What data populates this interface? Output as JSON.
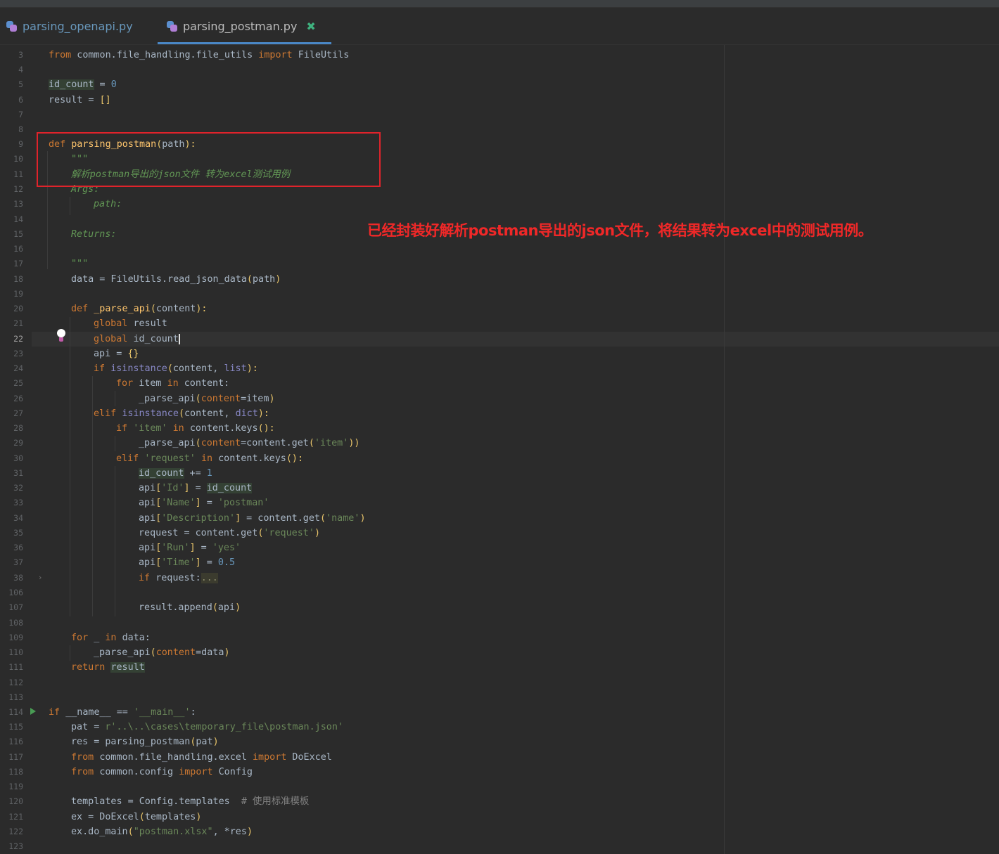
{
  "tabs": [
    {
      "label": "parsing_openapi.py"
    },
    {
      "label": "parsing_postman.py",
      "close": "✖"
    }
  ],
  "annotation": "已经封装好解析postman导出的json文件，将结果转为excel中的测试用例。",
  "line_numbers": [
    "3",
    "4",
    "5",
    "6",
    "7",
    "8",
    "9",
    "10",
    "11",
    "12",
    "13",
    "14",
    "15",
    "16",
    "17",
    "18",
    "19",
    "20",
    "21",
    "22",
    "23",
    "24",
    "25",
    "26",
    "27",
    "28",
    "29",
    "30",
    "31",
    "32",
    "33",
    "34",
    "35",
    "36",
    "37",
    "38",
    "106",
    "107",
    "108",
    "109",
    "110",
    "111",
    "112",
    "113",
    "114",
    "115",
    "116",
    "117",
    "118",
    "119",
    "120",
    "121",
    "122",
    "123"
  ],
  "current_line": "22",
  "code": {
    "l3": {
      "a": "from",
      "b": " common.file_handling.file_utils ",
      "c": "import",
      "d": " FileUtils"
    },
    "l5": {
      "a": "id_count",
      "b": " = ",
      "c": "0"
    },
    "l6": {
      "a": "result = ",
      "b": "[]"
    },
    "l9": {
      "a": "def ",
      "b": "parsing_postman",
      "c": "(",
      "d": "path",
      "e": "):"
    },
    "l10": "\"\"\"",
    "l11": "解析postman导出的json文件 转为excel测试用例",
    "l12": "Args:",
    "l13": "path:",
    "l15": "Returns:",
    "l17": "\"\"\"",
    "l18": {
      "a": "data = FileUtils.read_json_data",
      "b": "(",
      "c": "path",
      "d": ")"
    },
    "l20": {
      "a": "def ",
      "b": "_parse_api",
      "c": "(",
      "d": "content",
      "e": "):"
    },
    "l21": {
      "a": "global ",
      "b": "result"
    },
    "l22": {
      "a": "global ",
      "b": "id_count"
    },
    "l23": {
      "a": "api = ",
      "b": "{}"
    },
    "l24": {
      "a": "if ",
      "b": "isinstance",
      "c": "(",
      "d": "content, ",
      "e": "list",
      "f": "):"
    },
    "l25": {
      "a": "for ",
      "b": "item ",
      "c": "in ",
      "d": "content:"
    },
    "l26": {
      "a": "_parse_api",
      "b": "(",
      "c": "content",
      "d": "=item",
      ",e": "",
      "e": ")"
    },
    "l27": {
      "a": "elif ",
      "b": "isinstance",
      "c": "(",
      "d": "content, ",
      "e": "dict",
      "f": "):"
    },
    "l28": {
      "a": "if ",
      "b": "'item' ",
      "c": "in ",
      "d": "content.keys",
      "e": "():"
    },
    "l29": {
      "a": "_parse_api",
      "b": "(",
      "c": "content",
      "d": "=content.get",
      "e": "(",
      "f": "'item'",
      "g": "))"
    },
    "l30": {
      "a": "elif ",
      "b": "'request' ",
      "c": "in ",
      "d": "content.keys",
      "e": "():"
    },
    "l31": {
      "a": "id_count",
      " b": "",
      "b": " += ",
      "c": "1"
    },
    "l32": {
      "a": "api",
      "b": "[",
      "c": "'Id'",
      "d": "]",
      " e": "",
      "e": " = ",
      "f": "id_count"
    },
    "l33": {
      "a": "api",
      "b": "[",
      "c": "'Name'",
      "d": "]",
      "e": " = ",
      "f": "'postman'"
    },
    "l34": {
      "a": "api",
      "b": "[",
      "c": "'Description'",
      "d": "]",
      "e": " = content.get",
      "f": "(",
      "g": "'name'",
      "h": ")"
    },
    "l35": {
      "a": "request = content.get",
      "b": "(",
      "c": "'request'",
      "d": ")"
    },
    "l36": {
      "a": "api",
      "b": "[",
      "c": "'Run'",
      "d": "]",
      "e": " = ",
      "f": "'yes'"
    },
    "l37": {
      "a": "api",
      "b": "[",
      "c": "'Time'",
      "d": "]",
      "e": " = ",
      "f": "0.5"
    },
    "l38": {
      "a": "if ",
      "b": "request:",
      "c": "..."
    },
    "l107": {
      "a": "result.append",
      "b": "(",
      "c": "api",
      "d": ")"
    },
    "l109": {
      "a": "for ",
      "b": "_ ",
      "c": "in ",
      "d": "data:"
    },
    "l110": {
      "a": "_parse_api",
      "b": "(",
      "c": "content",
      "d": "=data",
      "e": ")"
    },
    "l111": {
      "a": "return ",
      "b": "result"
    },
    "l114": {
      "a": "if ",
      "b": "__name__ == ",
      "c": "'__main__'",
      "d": ":"
    },
    "l115": {
      "a": "pat = ",
      "b": "r'..\\..\\cases\\temporary_file\\postman.json'"
    },
    "l116": {
      "a": "res = parsing_postman",
      "b": "(",
      "c": "pat",
      "d": ")"
    },
    "l117": {
      "a": "from ",
      "b": "common.file_handling.excel ",
      "c": "import ",
      "d": "DoExcel"
    },
    "l118": {
      "a": "from ",
      "b": "common.config ",
      "c": "import ",
      "d": "Config"
    },
    "l120": {
      "a": "templates = Config.templates  ",
      "b": "# 使用标准模板"
    },
    "l121": {
      "a": "ex = DoExcel",
      "b": "(",
      "c": "templates",
      "d": ")"
    },
    "l122": {
      "a": "ex.do_main",
      "b": "(",
      "c": "\"postman.xlsx\"",
      "d": ", *res",
      "e": ")"
    }
  },
  "colors": {
    "background": "#2b2b2b",
    "keyword": "#cc7832",
    "function": "#ffc66d",
    "number": "#6897bb",
    "string": "#6a8759",
    "docstring": "#629755",
    "annotation": "#f02828"
  },
  "icons": [
    "python-file-icon",
    "close-icon",
    "lightbulb-icon",
    "run-icon",
    "fold-arrow-icon"
  ]
}
